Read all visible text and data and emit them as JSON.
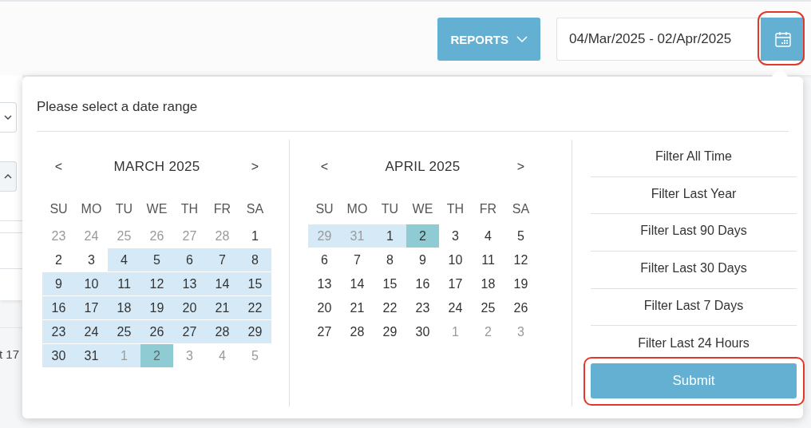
{
  "toolbar": {
    "reports_button": {
      "label": "REPORTS"
    },
    "date_range": {
      "value": "04/Mar/2025 - 02/Apr/2025"
    }
  },
  "background": {
    "partial_text": "t 17"
  },
  "popup": {
    "title": "Please select a date range",
    "months": [
      {
        "prev": "<",
        "title": "MARCH 2025",
        "next": ">",
        "weekdays": [
          "SU",
          "MO",
          "TU",
          "WE",
          "TH",
          "FR",
          "SA"
        ],
        "days": [
          {
            "day": "23",
            "outside": true,
            "in_range": false,
            "selected": false
          },
          {
            "day": "24",
            "outside": true,
            "in_range": false,
            "selected": false
          },
          {
            "day": "25",
            "outside": true,
            "in_range": false,
            "selected": false
          },
          {
            "day": "26",
            "outside": true,
            "in_range": false,
            "selected": false
          },
          {
            "day": "27",
            "outside": true,
            "in_range": false,
            "selected": false
          },
          {
            "day": "28",
            "outside": true,
            "in_range": false,
            "selected": false
          },
          {
            "day": "1",
            "outside": false,
            "in_range": false,
            "selected": false
          },
          {
            "day": "2",
            "outside": false,
            "in_range": false,
            "selected": false
          },
          {
            "day": "3",
            "outside": false,
            "in_range": false,
            "selected": false
          },
          {
            "day": "4",
            "outside": false,
            "in_range": true,
            "selected": false
          },
          {
            "day": "5",
            "outside": false,
            "in_range": true,
            "selected": false
          },
          {
            "day": "6",
            "outside": false,
            "in_range": true,
            "selected": false
          },
          {
            "day": "7",
            "outside": false,
            "in_range": true,
            "selected": false
          },
          {
            "day": "8",
            "outside": false,
            "in_range": true,
            "selected": false
          },
          {
            "day": "9",
            "outside": false,
            "in_range": true,
            "selected": false
          },
          {
            "day": "10",
            "outside": false,
            "in_range": true,
            "selected": false
          },
          {
            "day": "11",
            "outside": false,
            "in_range": true,
            "selected": false
          },
          {
            "day": "12",
            "outside": false,
            "in_range": true,
            "selected": false
          },
          {
            "day": "13",
            "outside": false,
            "in_range": true,
            "selected": false
          },
          {
            "day": "14",
            "outside": false,
            "in_range": true,
            "selected": false
          },
          {
            "day": "15",
            "outside": false,
            "in_range": true,
            "selected": false
          },
          {
            "day": "16",
            "outside": false,
            "in_range": true,
            "selected": false
          },
          {
            "day": "17",
            "outside": false,
            "in_range": true,
            "selected": false
          },
          {
            "day": "18",
            "outside": false,
            "in_range": true,
            "selected": false
          },
          {
            "day": "19",
            "outside": false,
            "in_range": true,
            "selected": false
          },
          {
            "day": "20",
            "outside": false,
            "in_range": true,
            "selected": false
          },
          {
            "day": "21",
            "outside": false,
            "in_range": true,
            "selected": false
          },
          {
            "day": "22",
            "outside": false,
            "in_range": true,
            "selected": false
          },
          {
            "day": "23",
            "outside": false,
            "in_range": true,
            "selected": false
          },
          {
            "day": "24",
            "outside": false,
            "in_range": true,
            "selected": false
          },
          {
            "day": "25",
            "outside": false,
            "in_range": true,
            "selected": false
          },
          {
            "day": "26",
            "outside": false,
            "in_range": true,
            "selected": false
          },
          {
            "day": "27",
            "outside": false,
            "in_range": true,
            "selected": false
          },
          {
            "day": "28",
            "outside": false,
            "in_range": true,
            "selected": false
          },
          {
            "day": "29",
            "outside": false,
            "in_range": true,
            "selected": false
          },
          {
            "day": "30",
            "outside": false,
            "in_range": true,
            "selected": false
          },
          {
            "day": "31",
            "outside": false,
            "in_range": true,
            "selected": false
          },
          {
            "day": "1",
            "outside": true,
            "in_range": true,
            "selected": false
          },
          {
            "day": "2",
            "outside": true,
            "in_range": false,
            "selected": true
          },
          {
            "day": "3",
            "outside": true,
            "in_range": false,
            "selected": false
          },
          {
            "day": "4",
            "outside": true,
            "in_range": false,
            "selected": false
          },
          {
            "day": "5",
            "outside": true,
            "in_range": false,
            "selected": false
          }
        ]
      },
      {
        "prev": "<",
        "title": "APRIL 2025",
        "next": ">",
        "weekdays": [
          "SU",
          "MO",
          "TU",
          "WE",
          "TH",
          "FR",
          "SA"
        ],
        "days": [
          {
            "day": "29",
            "outside": true,
            "in_range": true,
            "selected": false
          },
          {
            "day": "31",
            "outside": true,
            "in_range": true,
            "selected": false
          },
          {
            "day": "1",
            "outside": false,
            "in_range": true,
            "selected": false
          },
          {
            "day": "2",
            "outside": false,
            "in_range": false,
            "selected": true
          },
          {
            "day": "3",
            "outside": false,
            "in_range": false,
            "selected": false
          },
          {
            "day": "4",
            "outside": false,
            "in_range": false,
            "selected": false
          },
          {
            "day": "5",
            "outside": false,
            "in_range": false,
            "selected": false
          },
          {
            "day": "6",
            "outside": false,
            "in_range": false,
            "selected": false
          },
          {
            "day": "7",
            "outside": false,
            "in_range": false,
            "selected": false
          },
          {
            "day": "8",
            "outside": false,
            "in_range": false,
            "selected": false
          },
          {
            "day": "9",
            "outside": false,
            "in_range": false,
            "selected": false
          },
          {
            "day": "10",
            "outside": false,
            "in_range": false,
            "selected": false
          },
          {
            "day": "11",
            "outside": false,
            "in_range": false,
            "selected": false
          },
          {
            "day": "12",
            "outside": false,
            "in_range": false,
            "selected": false
          },
          {
            "day": "13",
            "outside": false,
            "in_range": false,
            "selected": false
          },
          {
            "day": "14",
            "outside": false,
            "in_range": false,
            "selected": false
          },
          {
            "day": "15",
            "outside": false,
            "in_range": false,
            "selected": false
          },
          {
            "day": "16",
            "outside": false,
            "in_range": false,
            "selected": false
          },
          {
            "day": "17",
            "outside": false,
            "in_range": false,
            "selected": false
          },
          {
            "day": "18",
            "outside": false,
            "in_range": false,
            "selected": false
          },
          {
            "day": "19",
            "outside": false,
            "in_range": false,
            "selected": false
          },
          {
            "day": "20",
            "outside": false,
            "in_range": false,
            "selected": false
          },
          {
            "day": "21",
            "outside": false,
            "in_range": false,
            "selected": false
          },
          {
            "day": "22",
            "outside": false,
            "in_range": false,
            "selected": false
          },
          {
            "day": "23",
            "outside": false,
            "in_range": false,
            "selected": false
          },
          {
            "day": "24",
            "outside": false,
            "in_range": false,
            "selected": false
          },
          {
            "day": "25",
            "outside": false,
            "in_range": false,
            "selected": false
          },
          {
            "day": "26",
            "outside": false,
            "in_range": false,
            "selected": false
          },
          {
            "day": "27",
            "outside": false,
            "in_range": false,
            "selected": false
          },
          {
            "day": "28",
            "outside": false,
            "in_range": false,
            "selected": false
          },
          {
            "day": "29",
            "outside": false,
            "in_range": false,
            "selected": false
          },
          {
            "day": "30",
            "outside": false,
            "in_range": false,
            "selected": false
          },
          {
            "day": "1",
            "outside": true,
            "in_range": false,
            "selected": false
          },
          {
            "day": "2",
            "outside": true,
            "in_range": false,
            "selected": false
          },
          {
            "day": "3",
            "outside": true,
            "in_range": false,
            "selected": false
          }
        ]
      }
    ],
    "filters": [
      {
        "label": "Filter All Time"
      },
      {
        "label": "Filter Last Year"
      },
      {
        "label": "Filter Last 90 Days"
      },
      {
        "label": "Filter Last 30 Days"
      },
      {
        "label": "Filter Last 7 Days"
      },
      {
        "label": "Filter Last 24 Hours"
      }
    ],
    "submit": {
      "label": "Submit"
    }
  }
}
